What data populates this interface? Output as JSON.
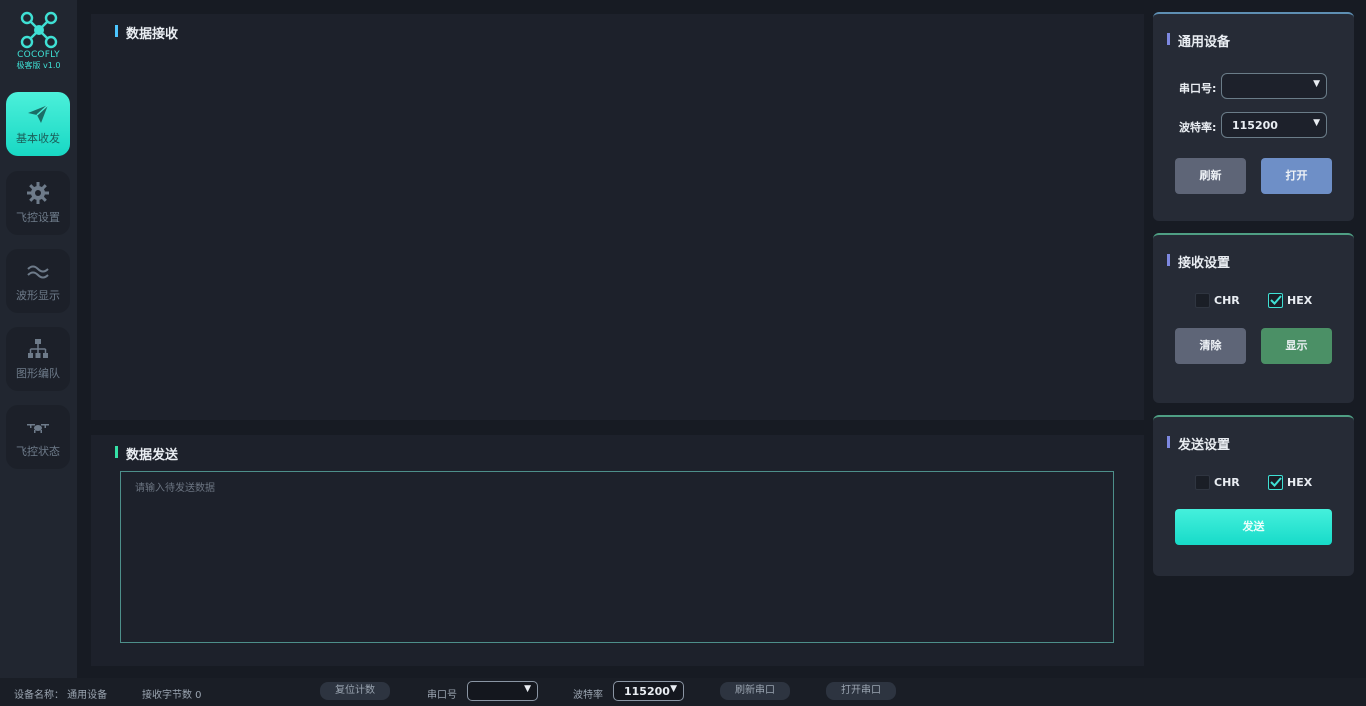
{
  "app": {
    "brand": "COCOFLY",
    "version": "极客版 v1.0"
  },
  "sidebar": {
    "items": [
      {
        "label": "基本收发",
        "icon": "send-icon",
        "active": true
      },
      {
        "label": "飞控设置",
        "icon": "gear-icon"
      },
      {
        "label": "波形显示",
        "icon": "wave-icon"
      },
      {
        "label": "图形编队",
        "icon": "hierarchy-icon"
      },
      {
        "label": "飞控状态",
        "icon": "drone-icon"
      }
    ]
  },
  "receive_panel": {
    "title": "数据接收"
  },
  "send_panel": {
    "title": "数据发送",
    "placeholder": "请输入待发送数据"
  },
  "device": {
    "title": "通用设备",
    "port_label": "串口号:",
    "port_value": "",
    "baud_label": "波特率:",
    "baud_value": "115200",
    "refresh_label": "刷新",
    "open_label": "打开"
  },
  "receive_settings": {
    "title": "接收设置",
    "chr_label": "CHR",
    "hex_label": "HEX",
    "chr_checked": false,
    "hex_checked": true,
    "clear_label": "清除",
    "show_label": "显示"
  },
  "send_settings": {
    "title": "发送设置",
    "chr_label": "CHR",
    "hex_label": "HEX",
    "chr_checked": false,
    "hex_checked": true,
    "send_label": "发送"
  },
  "statusbar": {
    "device_name": "设备名称： 通用设备",
    "rx_bytes": "接收字节数 0",
    "reset_label": "复位计数",
    "port_label": "串口号",
    "port_value": "",
    "baud_label": "波特率",
    "baud_value": "115200",
    "refresh_label": "刷新串口",
    "open_label": "打开串口"
  },
  "colors": {
    "accent": "#3fe0d4",
    "panel": "#1d212b",
    "background": "#171b23"
  }
}
